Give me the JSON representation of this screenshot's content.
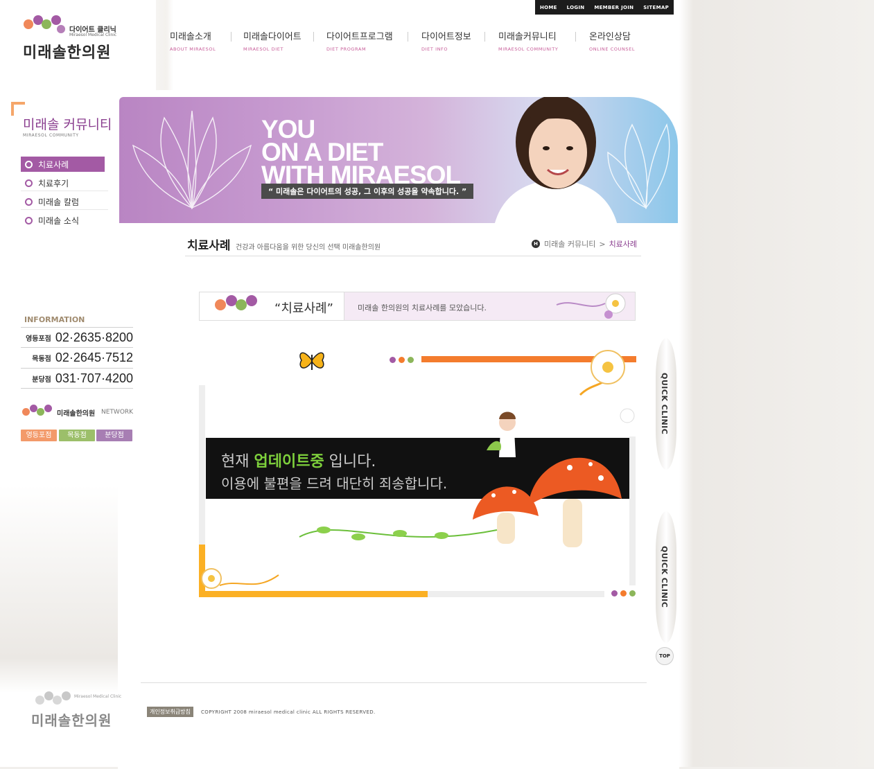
{
  "util_nav": [
    "HOME",
    "LOGIN",
    "MEMBER JOIN",
    "SITEMAP"
  ],
  "logo": {
    "sub_ko": "다이어트 클리닉",
    "sub_en": "Miraesol Medical Clinic",
    "main": "미래솔한의원"
  },
  "nav": [
    {
      "ko": "미래솔소개",
      "en": "ABOUT MIRAESOL"
    },
    {
      "ko": "미래솔다이어트",
      "en": "MIRAESOL DIET"
    },
    {
      "ko": "다이어트프로그램",
      "en": "DIET PROGRAM"
    },
    {
      "ko": "다이어트정보",
      "en": "DIET INFO"
    },
    {
      "ko": "미래솔커뮤니티",
      "en": "MIRAESOL COMMUNITY"
    },
    {
      "ko": "온라인상담",
      "en": "ONLINE COUNSEL"
    }
  ],
  "banner": {
    "line1": "YOU",
    "line2": "ON A DIET",
    "line3": "WITH MIRAESOL",
    "quote": "“ 미래솔은 다이어트의 성공, 그 이후의 성공을 약속합니다. ”"
  },
  "lnb": {
    "title": "미래솔 커뮤니티",
    "sub": "MIRAESOL COMMUNITY",
    "items": [
      "치료사례",
      "치료후기",
      "미래솔 칼럼",
      "미래솔 소식"
    ]
  },
  "info": {
    "title": "INFORMATION",
    "rows": [
      {
        "branch": "영등포점",
        "phone": "02·2635·8200"
      },
      {
        "branch": "목동점",
        "phone": "02·2645·7512"
      },
      {
        "branch": "분당점",
        "phone": "031·707·4200"
      }
    ]
  },
  "network": {
    "label": "미래솔한의원",
    "en": "NETWORK",
    "buttons": [
      "영등포점",
      "목동점",
      "분당점"
    ]
  },
  "page": {
    "title": "치료사례",
    "desc": "건강과 아름다움을 위한 당신의 선택 미래솔한의원",
    "crumb_icon": "H",
    "crumb_parent": "미래솔 커뮤니티",
    "crumb_sep": ">",
    "crumb_current": "치료사례"
  },
  "title_box": {
    "name": "“치료사례”",
    "desc": "미래솔 한의원의  치료사례를 모았습니다."
  },
  "notice": {
    "pre": "현재 ",
    "highlight": "업데이트중",
    "post": " 입니다.",
    "line2": "이용에 불편을 드려 대단히 죄송합니다."
  },
  "quick": {
    "label": "QUICK CLINIC",
    "top": "TOP"
  },
  "footer": {
    "privacy": "개인정보취급방침",
    "copy": "COPYRIGHT 2008 miraesol medical clinic ALL RIGHTS RESERVED.",
    "logo": "미래솔한의원",
    "logo_en": "Miraesol Medical Clinic"
  },
  "colors": {
    "purple": "#a35aa4",
    "orange": "#f47c2d",
    "green": "#8cb65a",
    "yellow": "#fbb024",
    "brown": "#a08b6f"
  }
}
